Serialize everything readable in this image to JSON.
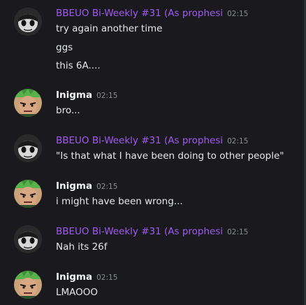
{
  "messages": [
    {
      "author": "BBEUO Bi-Weekly #31 (As prophesi",
      "author_style": "purple",
      "avatar": "masked-character-avatar",
      "time": "02:15",
      "lines": [
        "try again another time",
        "ggs",
        "this 6A...."
      ]
    },
    {
      "author": "Inigma",
      "author_style": "white",
      "avatar": "green-haired-character-avatar",
      "time": "02:15",
      "lines": [
        "bro..."
      ]
    },
    {
      "author": "BBEUO Bi-Weekly #31 (As prophesi",
      "author_style": "purple",
      "avatar": "masked-character-avatar",
      "time": "02:15",
      "lines": [
        "\"Is that what I have been doing to other people\""
      ]
    },
    {
      "author": "Inigma",
      "author_style": "white",
      "avatar": "green-haired-character-avatar",
      "time": "02:15",
      "lines": [
        "i might have been wrong..."
      ]
    },
    {
      "author": "BBEUO Bi-Weekly #31 (As prophesi",
      "author_style": "purple",
      "avatar": "masked-character-avatar",
      "time": "02:15",
      "lines": [
        "Nah its 26f"
      ]
    },
    {
      "author": "Inigma",
      "author_style": "white",
      "avatar": "green-haired-character-avatar",
      "time": "02:15",
      "lines": [
        "LMAOOO"
      ]
    }
  ],
  "colors": {
    "background": "#1a1a1e",
    "username_purple": "#a05af0",
    "username_white": "#f2f3f5",
    "timestamp": "#8a8d93",
    "message_text": "#e6e7ea"
  }
}
